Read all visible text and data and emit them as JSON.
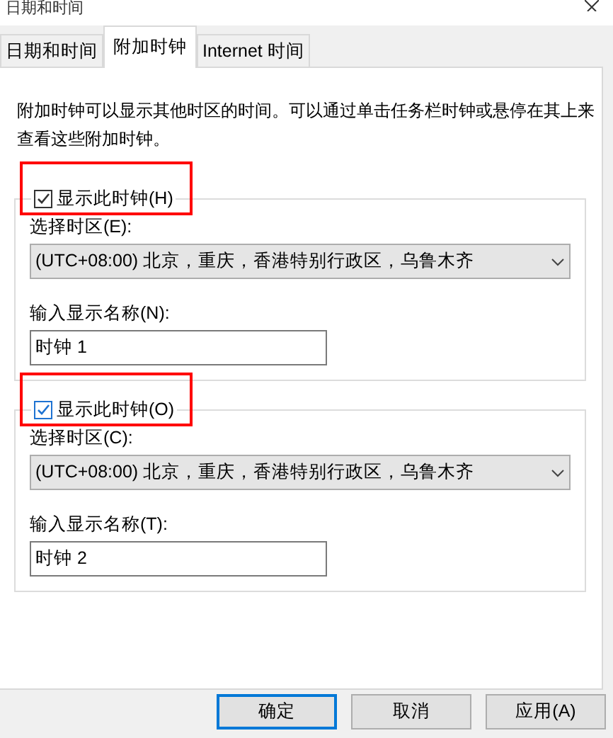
{
  "window": {
    "title": "日期和时间"
  },
  "tabs": [
    {
      "label": "日期和时间",
      "selected": false
    },
    {
      "label": "附加时钟",
      "selected": true
    },
    {
      "label": "Internet 时间",
      "selected": false
    }
  ],
  "description": "附加时钟可以显示其他时区的时间。可以通过单击任务栏时钟或悬停在其上来查看这些附加时钟。",
  "clocks": [
    {
      "show_label": "显示此时钟(H)",
      "checked": true,
      "focused": false,
      "highlighted": true,
      "timezone_label": "选择时区(E):",
      "timezone": "(UTC+08:00) 北京，重庆，香港特别行政区，乌鲁木齐",
      "name_label": "输入显示名称(N):",
      "name": "时钟 1"
    },
    {
      "show_label": "显示此时钟(O)",
      "checked": true,
      "focused": true,
      "highlighted": true,
      "timezone_label": "选择时区(C):",
      "timezone": "(UTC+08:00) 北京，重庆，香港特别行政区，乌鲁木齐",
      "name_label": "输入显示名称(T):",
      "name": "时钟 2"
    }
  ],
  "buttons": [
    {
      "label": "确定",
      "default": true
    },
    {
      "label": "取消",
      "default": false
    },
    {
      "label": "应用(A)",
      "default": false
    }
  ]
}
